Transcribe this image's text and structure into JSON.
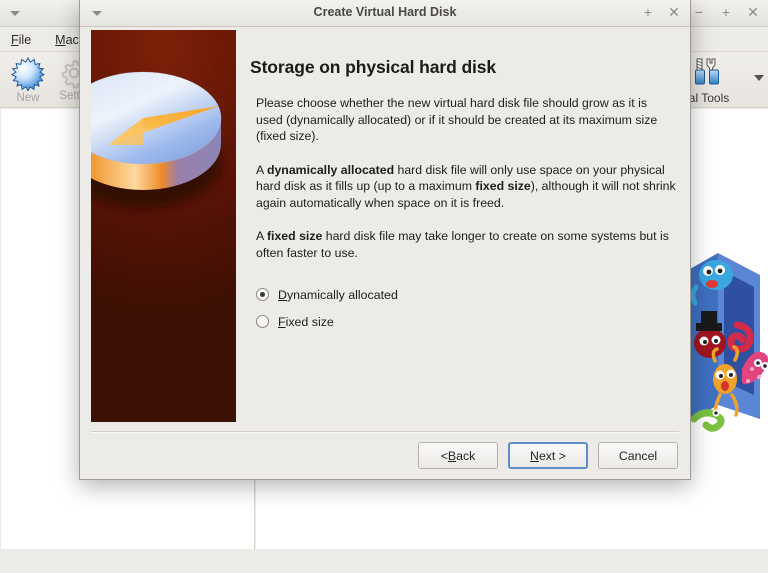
{
  "background_window": {
    "titlebar": {
      "window_menu_icon": "chevron-down-icon",
      "minimize_label": "−",
      "maximize_label": "+",
      "close_label": "✕"
    },
    "menus": [
      {
        "label": "File",
        "mnemonic": "F"
      },
      {
        "label": "Mach",
        "mnemonic": "M"
      }
    ],
    "toolbar": [
      {
        "label": "New",
        "icon": "new-star-icon",
        "enabled": true
      },
      {
        "label": "Settin",
        "icon": "gear-icon",
        "enabled": false
      }
    ],
    "global_tools": {
      "label": "lobal Tools",
      "icon": "tools-icon",
      "caret": "chevron-down-icon"
    }
  },
  "dialog": {
    "title": "Create Virtual Hard Disk",
    "titlebar": {
      "window_menu_icon": "chevron-down-icon",
      "maximize_label": "+",
      "close_label": "✕"
    },
    "heading": "Storage on physical hard disk",
    "paragraphs": [
      {
        "parts": [
          {
            "text": "Please choose whether the new virtual hard disk file should grow as it is used (dynamically allocated) or if it should be created at its maximum size (fixed size).",
            "bold": false
          }
        ]
      },
      {
        "parts": [
          {
            "text": "A ",
            "bold": false
          },
          {
            "text": "dynamically allocated",
            "bold": true
          },
          {
            "text": " hard disk file will only use space on your physical hard disk as it fills up (up to a maximum ",
            "bold": false
          },
          {
            "text": "fixed size",
            "bold": true
          },
          {
            "text": "), although it will not shrink again automatically when space on it is freed.",
            "bold": false
          }
        ]
      },
      {
        "parts": [
          {
            "text": "A ",
            "bold": false
          },
          {
            "text": "fixed size",
            "bold": true
          },
          {
            "text": " hard disk file may take longer to create on some systems but is often faster to use.",
            "bold": false
          }
        ]
      }
    ],
    "radio_options": [
      {
        "label": "Dynamically allocated",
        "mnemonic": "D",
        "before": "",
        "after": "ynamically allocated",
        "selected": true
      },
      {
        "label": "Fixed size",
        "mnemonic": "F",
        "before": "",
        "after": "ixed size",
        "selected": false
      }
    ],
    "buttons": [
      {
        "label": "< Back",
        "before": "< ",
        "mnemonic": "B",
        "after": "ack",
        "focused": false
      },
      {
        "label": "Next >",
        "before": "",
        "mnemonic": "N",
        "after": "ext >",
        "focused": true
      },
      {
        "label": "Cancel",
        "before": "Cancel",
        "mnemonic": "",
        "after": "",
        "focused": false
      }
    ],
    "illustration": {
      "name": "pie-chart-illustration",
      "background_top": "#7c2108",
      "background_bottom": "#3c1004",
      "pie_body": "#bcd2f2",
      "pie_slice": "#f8b13c"
    }
  },
  "colors": {
    "dialog_background": "#edebe7",
    "focus_border": "#5b8fc9",
    "text": "#1e1d1b",
    "titlebar_text": "#4a4845"
  }
}
